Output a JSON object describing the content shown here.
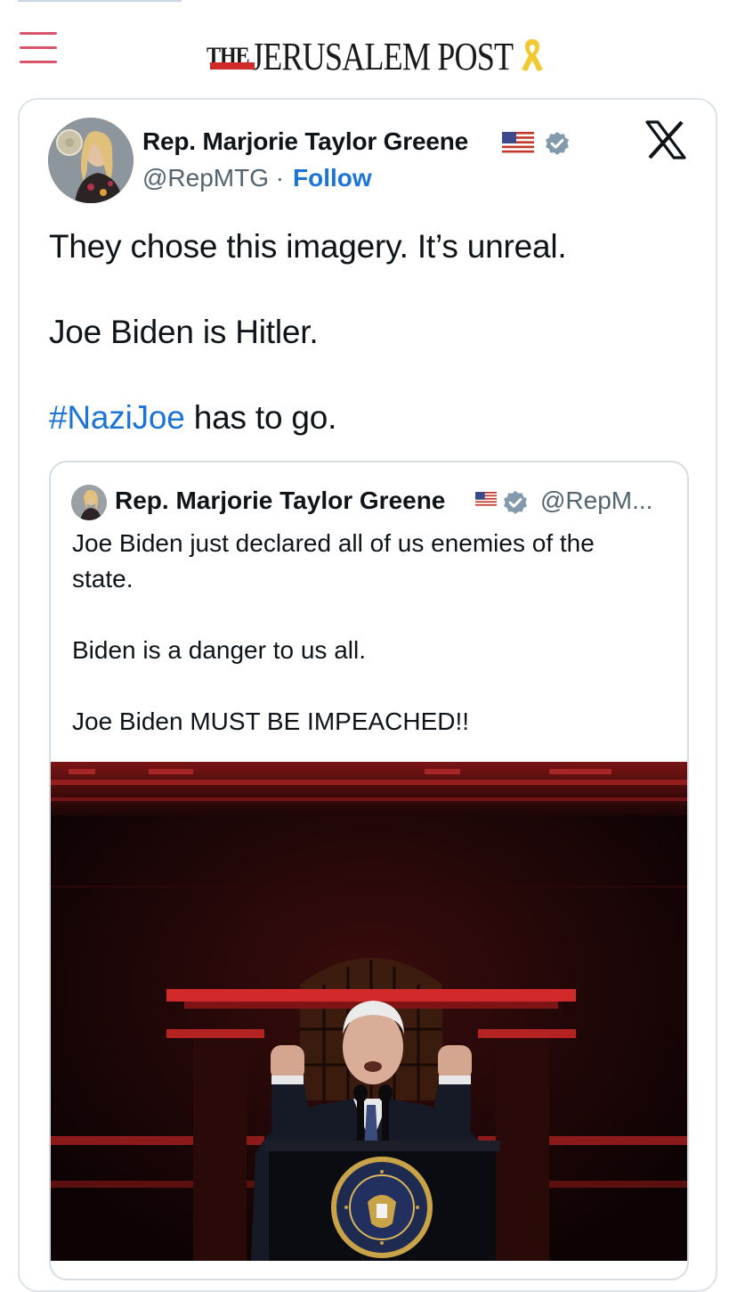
{
  "site": {
    "logo_the": "THE",
    "logo_main": "JERUSALEM POST",
    "accent_color": "#d02a2a",
    "menu_color": "#d9556b"
  },
  "tweet": {
    "author_name": "Rep. Marjorie Taylor Greene",
    "handle": "@RepMTG",
    "separator": "·",
    "follow_label": "Follow",
    "lines": [
      "They chose this imagery. It’s unreal.",
      "Joe Biden is Hitler."
    ],
    "hashtag": "#NaziJoe",
    "hashtag_tail": " has to go.",
    "link_color": "#1d74d8"
  },
  "quoted": {
    "author_name": "Rep. Marjorie Taylor Greene",
    "handle": "@RepM...",
    "lines": [
      "Joe Biden just declared all of us enemies of the",
      "state.",
      "Biden is a danger to us all.",
      "Joe Biden MUST BE IMPEACHED!!"
    ]
  },
  "icons": {
    "menu": "hamburger-icon",
    "platform": "x-logo-icon",
    "verified": "verified-badge-icon",
    "flag": "us-flag-icon",
    "ribbon": "yellow-ribbon-icon"
  }
}
